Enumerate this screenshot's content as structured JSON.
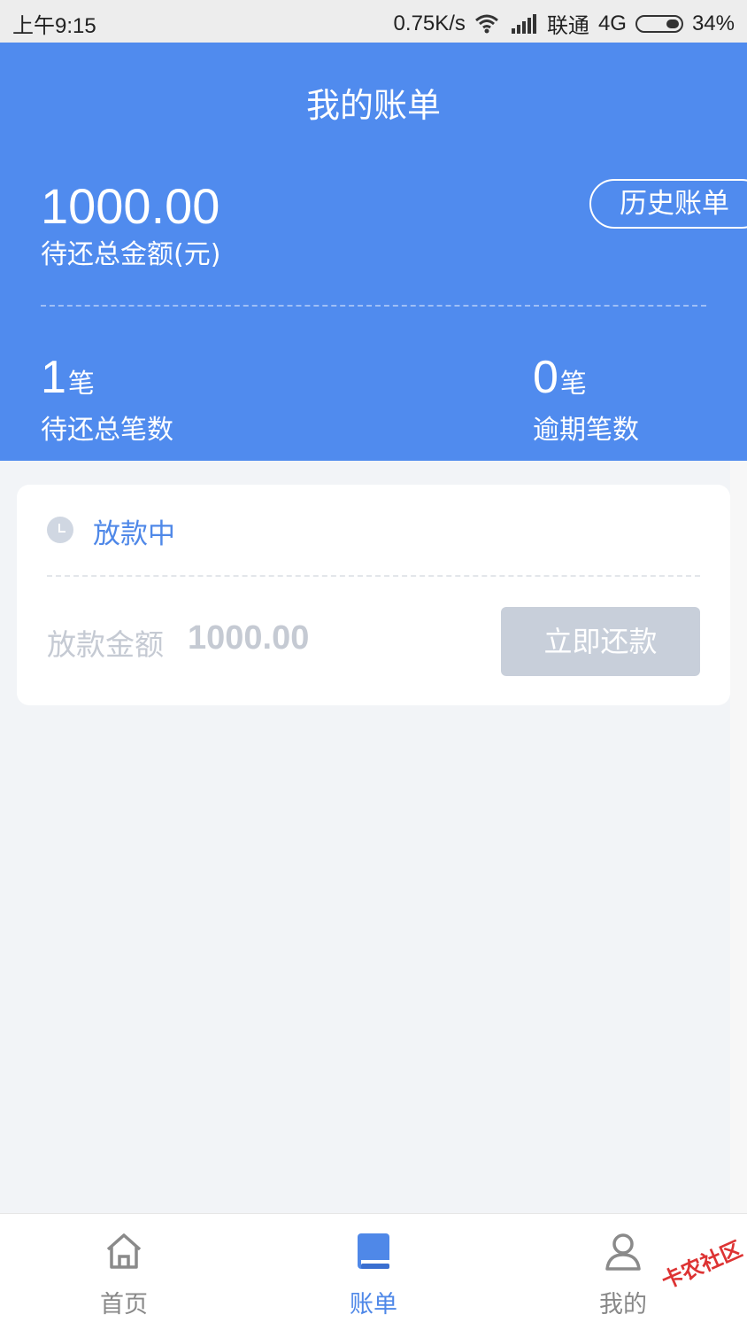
{
  "status_bar": {
    "time": "上午9:15",
    "speed": "0.75K/s",
    "carrier": "联通",
    "network": "4G",
    "battery": "34%"
  },
  "header": {
    "title": "我的账单",
    "total_amount": "1000.00",
    "total_label": "待还总金额(元)",
    "history_button": "历史账单",
    "pending_count": "1",
    "pending_unit": "笔",
    "pending_label": "待还总笔数",
    "overdue_count": "0",
    "overdue_unit": "笔",
    "overdue_label": "逾期笔数",
    "bg_color": "#508bee"
  },
  "loan_card": {
    "status": "放款中",
    "amount_label": "放款金额",
    "amount_value": "1000.00",
    "repay_button": "立即还款",
    "status_color": "#4f88e8"
  },
  "bottom_nav": {
    "items": [
      {
        "label": "首页",
        "icon": "home-icon",
        "active": false
      },
      {
        "label": "账单",
        "icon": "bill-book-icon",
        "active": true
      },
      {
        "label": "我的",
        "icon": "user-icon",
        "active": false
      }
    ]
  },
  "watermark": "卡农社区"
}
